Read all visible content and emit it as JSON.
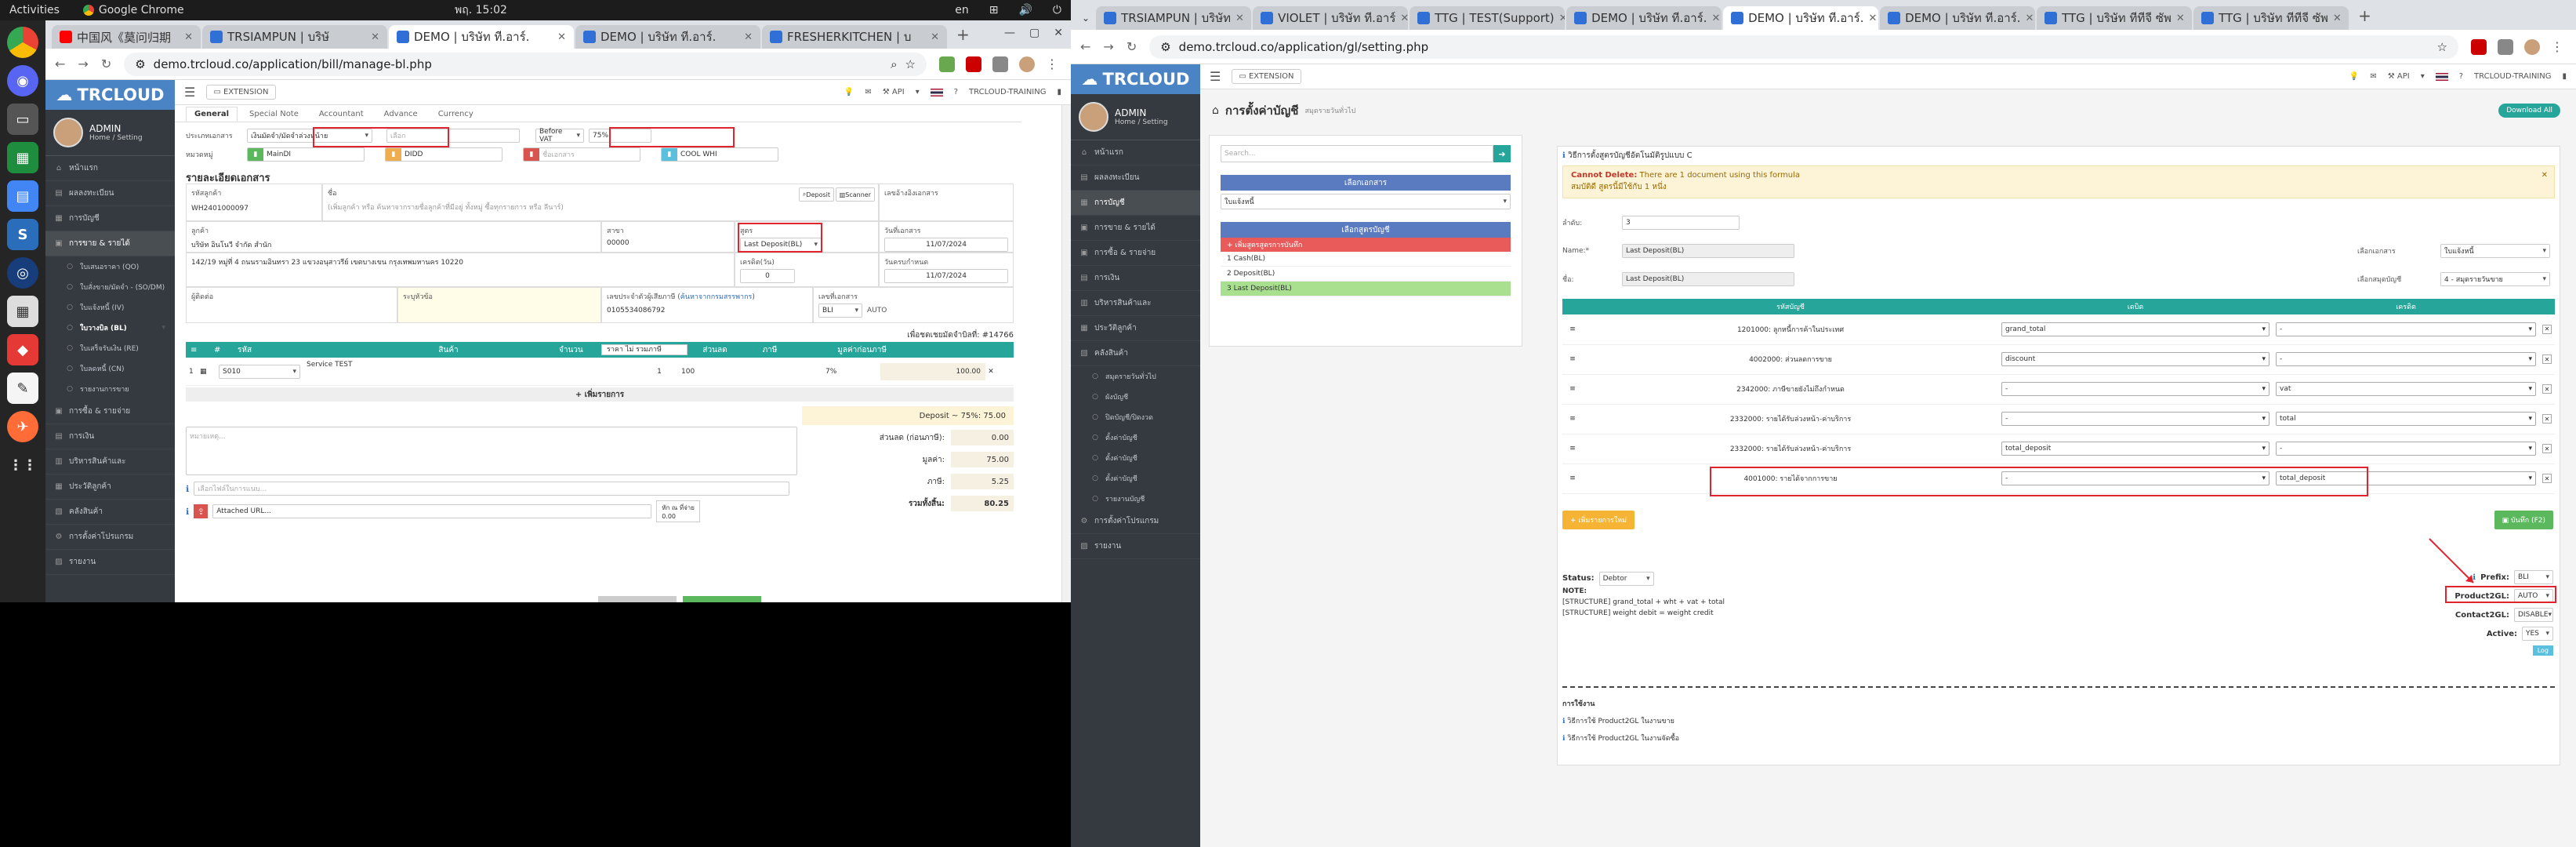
{
  "system": {
    "activities": "Activities",
    "app_name": "Google Chrome",
    "clock": "พฤ. 15:02",
    "lang": "en",
    "tray": [
      "⊞",
      "🔊",
      "⏻"
    ]
  },
  "left_window": {
    "tabs": [
      {
        "label": "中国风《莫问归期",
        "color": "#ff0000"
      },
      {
        "label": "TRSIAMPUN | บริษั",
        "color": "#2f6fd6"
      },
      {
        "label": "DEMO | บริษัท ที.อาร์.",
        "color": "#2f6fd6",
        "active": true
      },
      {
        "label": "DEMO | บริษัท ที.อาร์.",
        "color": "#2f6fd6"
      },
      {
        "label": "FRESHERKITCHEN | บ",
        "color": "#2f6fd6"
      }
    ],
    "url": "demo.trcloud.co/application/bill/manage-bl.php",
    "logo": "TRCLOUD",
    "user": {
      "name": "ADMIN",
      "sub": "Home / Setting"
    },
    "nav": [
      {
        "label": "หน้าแรก",
        "icon": "⌂"
      },
      {
        "label": "ผลลงทะเบียน",
        "icon": "▤"
      },
      {
        "label": "การบัญชี",
        "icon": "▦"
      },
      {
        "label": "การขาย & รายได้",
        "icon": "▣",
        "active": true
      }
    ],
    "subnav": [
      {
        "label": "ใบเสนอราคา (QO)"
      },
      {
        "label": "ใบสั่งขาย/มัดจำ - (SO/DM)"
      },
      {
        "label": "ใบแจ้งหนี้ (IV)"
      },
      {
        "label": "ใบวางบิล (BL)",
        "selected": true
      },
      {
        "label": "ใบเสร็จรับเงิน (RE)"
      },
      {
        "label": "ใบลดหนี้ (CN)"
      },
      {
        "label": "รายงานการขาย"
      }
    ],
    "nav2": [
      {
        "label": "การซื้อ & รายจ่าย",
        "icon": "▣"
      },
      {
        "label": "การเงิน",
        "icon": "▤"
      },
      {
        "label": "บริหารสินค้าและ",
        "icon": "▥"
      },
      {
        "label": "ประวัติลูกค้า",
        "icon": "▦"
      },
      {
        "label": "คลังสินค้า",
        "icon": "▧"
      },
      {
        "label": "การตั้งค่าโปรแกรม",
        "icon": "⚙"
      },
      {
        "label": "รายงาน",
        "icon": "▨"
      }
    ],
    "topnav": {
      "extension": "EXTENSION",
      "api": "API",
      "company": "TRCLOUD-TRAINING"
    },
    "subtabs": [
      "General",
      "Special Note",
      "Accountant",
      "Advance",
      "Currency"
    ],
    "doc_type_label": "ประเภทเอกสาร",
    "doc_type_value": "เงินมัดจำ/มัดจำล่วงหน้าย",
    "doc_no_placeholder": "เลือก",
    "vat_select": "Before VAT",
    "vat_rate": "75%",
    "group_label": "หมวดหมู่",
    "chips": [
      {
        "label": "MainDI",
        "color": "#5cb85c"
      },
      {
        "label": "DIDD",
        "color": "#f0ad4e"
      },
      {
        "label": "ชื่อเอกสาร",
        "color": "#d9534f"
      },
      {
        "label": "COOL WHI",
        "color": "#5bc0de"
      }
    ],
    "doc_section_title": "รายละเอียดเอกสาร",
    "customer_id_label": "รหัสลูกค้า",
    "customer_id": "WH2401000097",
    "name_label": "ชื่อ",
    "name_hint": "(เพิ่มลูกค้า หรือ ค้นหาจากรายชื่อลูกค้าที่มีอยู่ ทั้งหมู่ ซื้อทุกรายการ หรือ ลีนาร์)",
    "deposit_btn": "Deposit",
    "scanner_btn": "Scanner",
    "ref_label": "เลขอ้างอิงเอกสาร",
    "company_label": "ลูกค้า",
    "company_value": "บริษัท อินโนวี จำกัด สำนัก",
    "branch_label": "สาขา",
    "branch_value": "00000",
    "formula_label": "สูตร",
    "formula_value": "Last Deposit(BL)",
    "date_label": "วันที่เอกสาร",
    "date_value": "11/07/2024",
    "address": "142/19 หมู่ที่ 4 ถนนรามอินทรา 23 แขวงอนุสาวรีย์ เขตบางเขน กรุงเทพมหานคร 10220",
    "credit_label": "เครดิต(วัน)",
    "credit_value": "0",
    "due_label": "วันครบกำหนด",
    "due_value": "11/07/2024",
    "contact_label": "ผู้ติดต่อ",
    "remark_label": "ระบุหัวข้อ",
    "taxid_label": "เลขประจำตัวผู้เสียภาษี",
    "taxid_link": "ค้นหาจากกรมสรรพากร",
    "taxid_value": "0105534086792",
    "running_label": "เลขที่เอกสาร",
    "running_select": "BLI",
    "running_auto": "AUTO",
    "deposit_note": "เพื่อชดเชยมัดจำบิลที่: #14766",
    "item_headers": [
      "#",
      "รหัส",
      "สินค้า",
      "จำนวน",
      "ราคา ไม่ รวมภาษี",
      "ส่วนลด",
      "ภาษี",
      "มูลค่าก่อนภาษี"
    ],
    "item": {
      "no": "1",
      "code": "S010",
      "name": "Service TEST",
      "qty": "1",
      "price": "100",
      "vat": "7%",
      "amount": "100.00"
    },
    "add_item": "+ เพิ่มรายการ",
    "deposit_line": "Deposit ~ 75%: 75.00",
    "note_placeholder": "หมายเหตุ...",
    "totals": [
      {
        "label": "ส่วนลด (ก่อนภาษี):",
        "value": "0.00"
      },
      {
        "label": "มูลค่า:",
        "value": "75.00"
      },
      {
        "label": "ภาษี:",
        "value": "5.25"
      },
      {
        "label": "รวมทั้งสิ้น:",
        "value": "80.25"
      }
    ],
    "attach_placeholder": "เลือกไฟล์ในการแนบ...",
    "attach_url": "Attached URL...",
    "wht_label": "หัก ณ ที่จ่าย",
    "wht_value": "0.00"
  },
  "right_window": {
    "tabs": [
      {
        "label": "TRSIAMPUN | บริษัท",
        "color": "#2f6fd6"
      },
      {
        "label": "VIOLET | บริษัท ที.อาร์",
        "color": "#2f6fd6"
      },
      {
        "label": "TTG | TEST(Support)",
        "color": "#2f6fd6"
      },
      {
        "label": "DEMO | บริษัท ที.อาร์.",
        "color": "#2f6fd6"
      },
      {
        "label": "DEMO | บริษัท ที.อาร์.",
        "color": "#2f6fd6",
        "active": true
      },
      {
        "label": "DEMO | บริษัท ที.อาร์.",
        "color": "#2f6fd6"
      },
      {
        "label": "TTG | บริษัท ทีทีจี ซัพ",
        "color": "#2f6fd6"
      },
      {
        "label": "TTG | บริษัท ทีทีจี ซัพ",
        "color": "#2f6fd6"
      }
    ],
    "url": "demo.trcloud.co/application/gl/setting.php",
    "logo": "TRCLOUD",
    "user": {
      "name": "ADMIN",
      "sub": "Home / Setting"
    },
    "nav": [
      {
        "label": "หน้าแรก",
        "icon": "⌂"
      },
      {
        "label": "ผลลงทะเบียน",
        "icon": "▤"
      },
      {
        "label": "การบัญชี",
        "icon": "▦",
        "active": true
      },
      {
        "label": "การขาย & รายได้",
        "icon": "▣"
      },
      {
        "label": "การซื้อ & รายจ่าย",
        "icon": "▣"
      },
      {
        "label": "การเงิน",
        "icon": "▤"
      },
      {
        "label": "บริหารสินค้าและ",
        "icon": "▥"
      },
      {
        "label": "ประวัติลูกค้า",
        "icon": "▦"
      },
      {
        "label": "คลังสินค้า",
        "icon": "▧"
      }
    ],
    "subnav": [
      {
        "label": "สมุดรายวันทั่วไป"
      },
      {
        "label": "ผังบัญชี"
      },
      {
        "label": "ปิดบัญชี/ปิดงวด"
      },
      {
        "label": "ตั้งค่าบัญชี"
      },
      {
        "label": "ตั้งค่าบัญชี"
      },
      {
        "label": "ตั้งค่าบัญชี"
      },
      {
        "label": "รายงานบัญชี"
      }
    ],
    "nav2": [
      {
        "label": "การตั้งค่าโปรแกรม",
        "icon": "⚙"
      },
      {
        "label": "รายงาน",
        "icon": "▨"
      }
    ],
    "topnav": {
      "extension": "EXTENSION",
      "api": "API",
      "company": "TRCLOUD-TRAINING"
    },
    "page_title": "การตั้งค่าบัญชี",
    "page_sub": "สมุดรายวันทั่วไป",
    "download_btn": "Download All",
    "search_placeholder": "Search...",
    "choose_doc": "เลือกเอกสาร",
    "choose_doc_value": "ใบแจ้งหนี้",
    "choose_formula": "เลือกสูตรบัญชี",
    "add_formula": "+ เพิ่มสูตรสูตรการบันทึก",
    "formula_list": [
      {
        "label": "1 Cash(BL)"
      },
      {
        "label": "2 Deposit(BL)"
      },
      {
        "label": "3 Last Deposit(BL)",
        "selected": true
      }
    ],
    "header_line": "วิธีการตั้งสูตรบัญชีอัตโนมัติรูปแบบ C",
    "alert_title": "Cannot Delete:",
    "alert_text": "There are 1 document using this formula",
    "alert_sub": "สมบัติดี สูตรนี้มีใช้กับ 1 หนึ่ง",
    "seq_label": "ลำดับ:",
    "seq_value": "3",
    "name_label": "Name:*",
    "name_value": "Last Deposit(BL)",
    "name2_label": "ชื่อ:",
    "name2_value": "Last Deposit(BL)",
    "choose_doc_label": "เลือกเอกสาร",
    "choose_doc_select": "ใบแจ้งหนี้",
    "choose_book_label": "เลือกสมุดบัญชี",
    "choose_book_select": "4 - สมุดรายวันขาย",
    "col_headers": [
      "รหัสบัญชี",
      "เดบิต",
      "เครดิต"
    ],
    "rows": [
      {
        "account": "1201000: ลูกหนี้การค้าในประเทศ",
        "debit": "grand_total",
        "credit": "-"
      },
      {
        "account": "4002000: ส่วนลดการขาย",
        "debit": "discount",
        "credit": "-"
      },
      {
        "account": "2342000: ภาษีขายยังไม่ถึงกำหนด",
        "debit": "-",
        "credit": "vat"
      },
      {
        "account": "2332000: รายได้รับล่วงหน้า-ค่าบริการ",
        "debit": "-",
        "credit": "total"
      },
      {
        "account": "2332000: รายได้รับล่วงหน้า-ค่าบริการ",
        "debit": "total_deposit",
        "credit": "-"
      },
      {
        "account": "4001000: รายได้จากการขาย",
        "debit": "-",
        "credit": "total_deposit"
      }
    ],
    "add_row_btn": "+ เพิ่มรายการใหม่",
    "save_btn": "บันทึก (F2)",
    "status_label": "Status:",
    "status_value": "Debtor",
    "note_label": "NOTE:",
    "structure1": "[STRUCTURE] grand_total + wht + vat + total",
    "structure2": "[STRUCTURE] weight debit = weight credit",
    "prefix_label": "Prefix:",
    "prefix_value": "BLI",
    "product2gl_label": "Product2GL:",
    "product2gl_value": "AUTO",
    "contact2gl_label": "Contact2GL:",
    "contact2gl_value": "DISABLE",
    "active_label": "Active:",
    "active_value": "YES",
    "log_btn": "Log",
    "usage_title": "การใช้งาน",
    "usage_links": [
      "วิธีการใช้ Product2GL ในงานขาย",
      "วิธีการใช้ Product2GL ในงานจัดซื้อ"
    ]
  }
}
